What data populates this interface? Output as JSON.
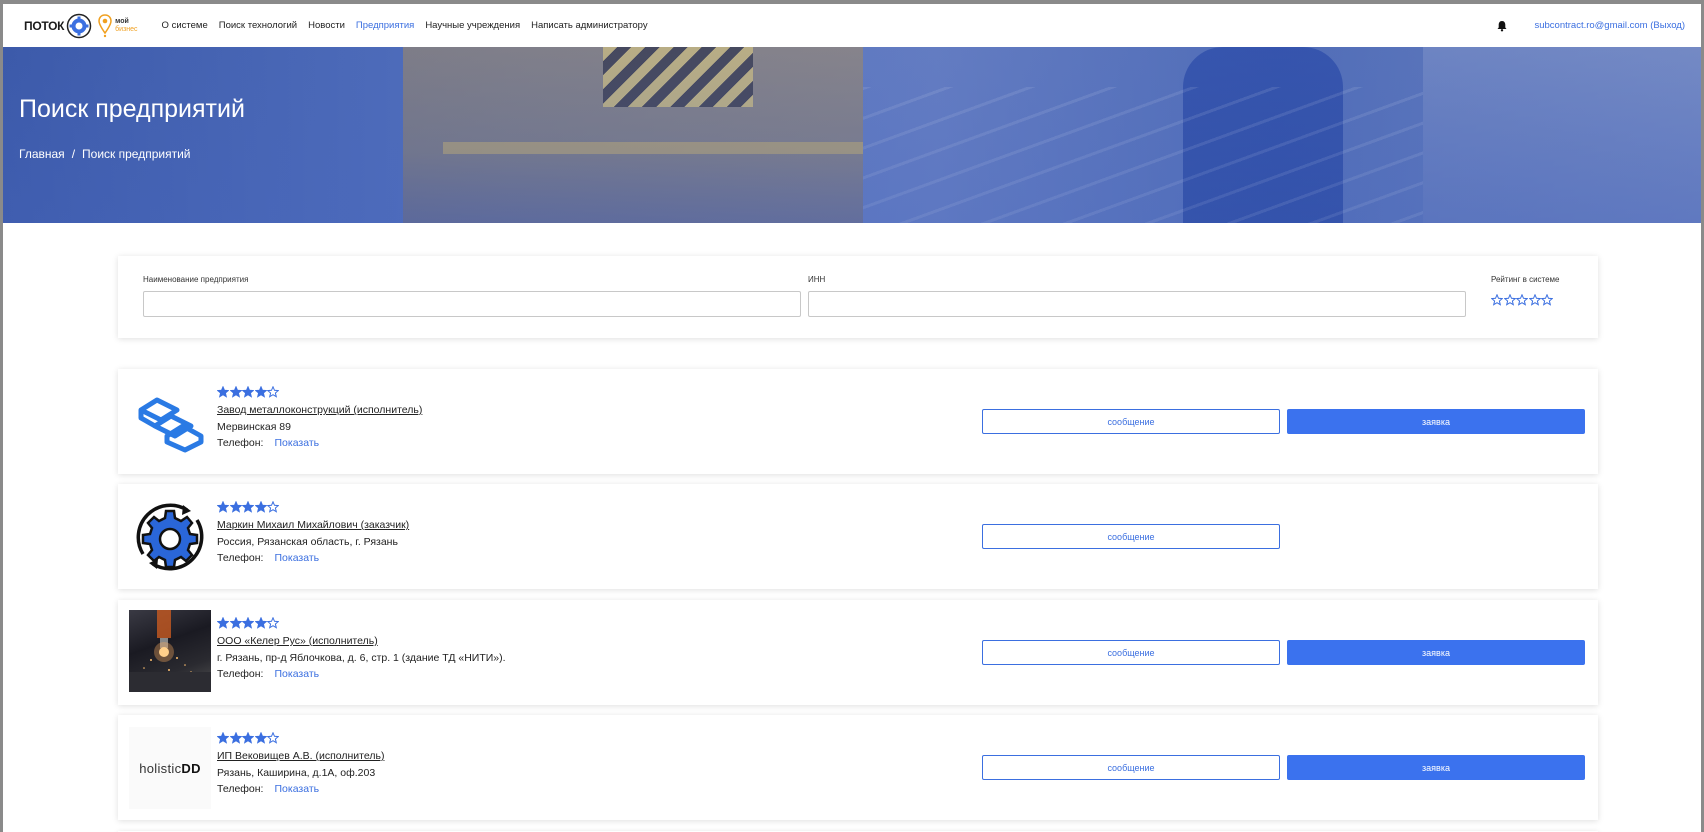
{
  "header": {
    "logo_text": "ПОТОК",
    "logo_biz_top": "мой",
    "logo_biz_bottom": "бизнес",
    "nav": [
      {
        "label": "О системе",
        "active": false
      },
      {
        "label": "Поиск технологий",
        "active": false
      },
      {
        "label": "Новости",
        "active": false
      },
      {
        "label": "Предприятия",
        "active": true
      },
      {
        "label": "Научные учреждения",
        "active": false
      },
      {
        "label": "Написать администратору",
        "active": false
      }
    ],
    "user_link": "subcontract.ro@gmail.com (Выход)"
  },
  "hero": {
    "title": "Поиск предприятий",
    "breadcrumb": [
      "Главная",
      "/",
      "Поиск предприятий"
    ]
  },
  "filters": {
    "name_label": "Наименование предприятия",
    "name_value": "",
    "inn_label": "ИНН",
    "inn_value": "",
    "rating_label": "Рейтинг в системе",
    "rating_value": 0,
    "rating_max": 5
  },
  "companies": [
    {
      "logo": "hexagon-chain-icon",
      "rating": 4,
      "name": "Завод металлоконструкций (исполнитель)",
      "address": "Мервинская 89",
      "phone_label": "Телефон:",
      "phone_action": "Показать",
      "message_label": "сообщение",
      "request_label": "заявка",
      "has_request": true
    },
    {
      "logo": "gear-cycle-icon",
      "rating": 4,
      "name": "Маркин Михаил Михайлович (заказчик)",
      "address": "Россия, Рязанская область, г. Рязань",
      "phone_label": "Телефон:",
      "phone_action": "Показать",
      "message_label": "сообщение",
      "request_label": "",
      "has_request": false
    },
    {
      "logo": "laser-cutting-photo",
      "rating": 4,
      "name": "ООО «Келер Рус» (исполнитель)",
      "address": "г. Рязань, пр-д Яблочкова, д. 6, стр. 1 (здание ТД «НИТИ»).",
      "phone_label": "Телефон:",
      "phone_action": "Показать",
      "message_label": "сообщение",
      "request_label": "заявка",
      "has_request": true
    },
    {
      "logo": "holisticdd-logo",
      "logo_text_light": "holistic",
      "logo_text_bold": "DD",
      "rating": 4,
      "name": "ИП Вековищев А.В. (исполнитель)",
      "address": "Рязань, Каширина, д.1А, оф.203",
      "phone_label": "Телефон:",
      "phone_action": "Показать",
      "message_label": "сообщение",
      "request_label": "заявка",
      "has_request": true
    }
  ],
  "colors": {
    "accent": "#3b72ee",
    "link": "#3b6fe0",
    "star": "#3b6fe0"
  }
}
